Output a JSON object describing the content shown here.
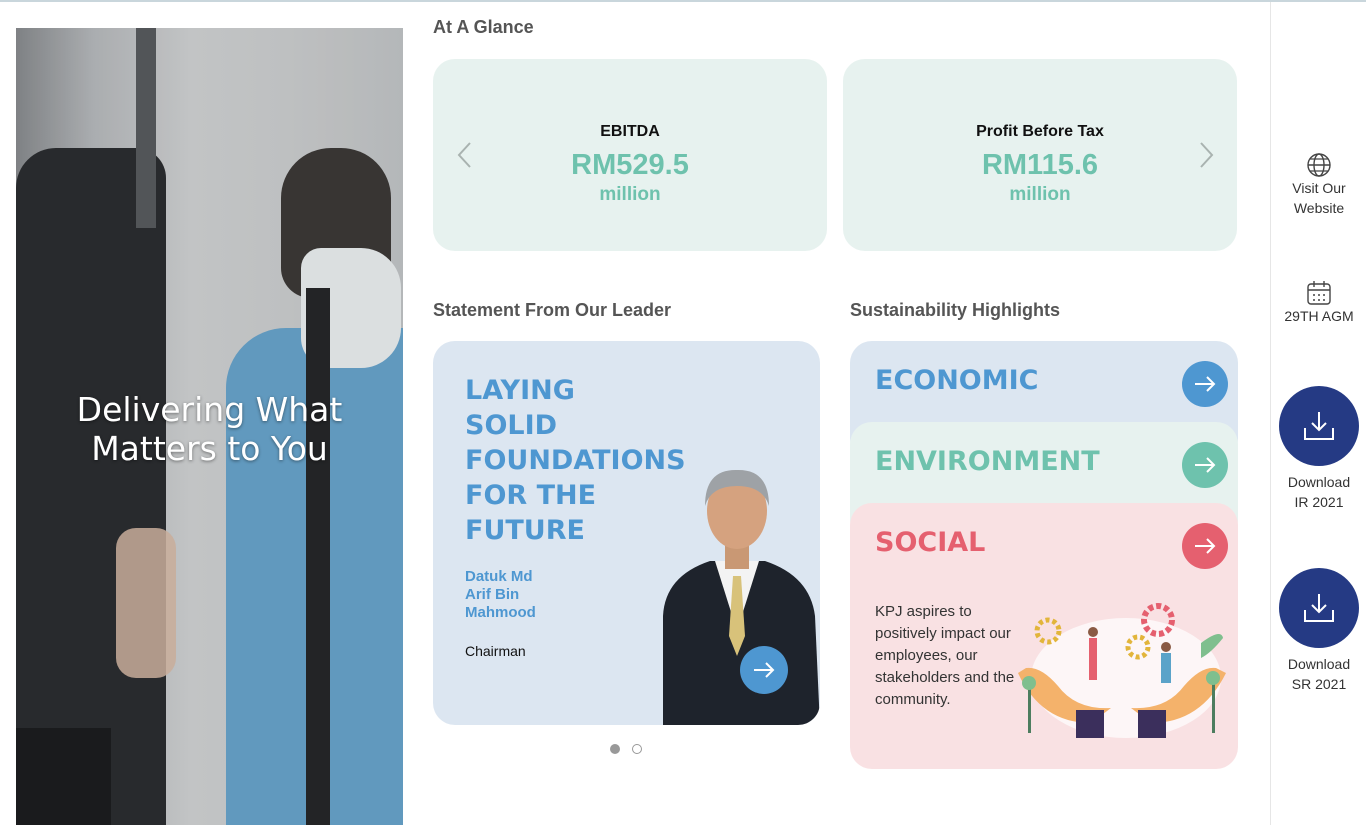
{
  "hero": {
    "title_line1": "Delivering What",
    "title_line2": "Matters to You"
  },
  "glance": {
    "title": "At A Glance",
    "cards": [
      {
        "label": "EBITDA",
        "value": "RM529.5",
        "unit": "million"
      },
      {
        "label": "Profit Before Tax",
        "value": "RM115.6",
        "unit": "million"
      }
    ],
    "prev_icon": "chevron-left-icon",
    "next_icon": "chevron-right-icon"
  },
  "leader": {
    "section_title": "Statement From Our Leader",
    "headline": [
      "LAYING",
      "SOLID",
      "FOUNDATIONS",
      "FOR THE",
      "FUTURE"
    ],
    "name": [
      "Datuk Md",
      "Arif Bin",
      "Mahmood"
    ],
    "role": "Chairman",
    "arrow_icon": "arrow-right-icon",
    "carousel_pages": 2,
    "carousel_active": 1
  },
  "sustainability": {
    "section_title": "Sustainability Highlights",
    "items": [
      {
        "title": "ECONOMIC",
        "color": "#4e97d1",
        "bg": "#dce6f1"
      },
      {
        "title": "ENVIRONMENT",
        "color": "#6ec2ad",
        "bg": "#e7f2ef"
      },
      {
        "title": "SOCIAL",
        "color": "#e5606f",
        "bg": "#f9e1e3"
      }
    ],
    "social_text": "KPJ aspires to positively impact our employees, our stakeholders and the community."
  },
  "sidebar": {
    "website_label_1": "Visit Our",
    "website_label_2": "Website",
    "agm_label": "29TH AGM",
    "download_ir_1": "Download",
    "download_ir_2": "IR 2021",
    "download_sr_1": "Download",
    "download_sr_2": "SR 2021",
    "accent": "#253a84"
  }
}
